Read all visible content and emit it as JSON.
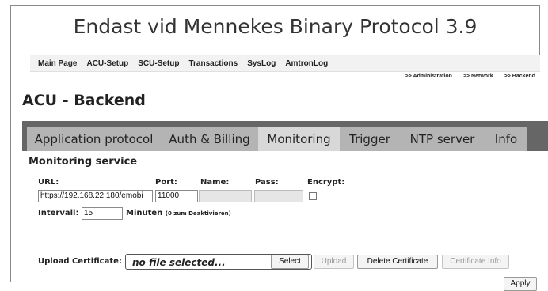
{
  "heading": "Endast vid Mennekes Binary Protocol 3.9",
  "topmenu": [
    "Main Page",
    "ACU-Setup",
    "SCU-Setup",
    "Transactions",
    "SysLog",
    "AmtronLog"
  ],
  "breadcrumbs": [
    ">> Administration",
    ">> Network",
    ">> Backend"
  ],
  "page_title": "ACU - Backend",
  "tabs": [
    "Application protocol",
    "Auth & Billing",
    "Monitoring",
    "Trigger",
    "NTP server",
    "Info"
  ],
  "active_tab": "Monitoring",
  "section_title": "Monitoring service",
  "form": {
    "url_label": "URL:",
    "url_value": "https://192.168.22.180/emobi",
    "port_label": "Port:",
    "port_value": "11000",
    "name_label": "Name:",
    "name_value": "",
    "pass_label": "Pass:",
    "pass_value": "",
    "encrypt_label": "Encrypt:",
    "encrypt_checked": false,
    "intervall_label": "Intervall:",
    "intervall_value": "15",
    "minuten_label": "Minuten",
    "minuten_hint": "(0 zum Deaktivieren)"
  },
  "upload": {
    "label": "Upload Certificate:",
    "file_text": "no file selected...",
    "select": "Select",
    "upload": "Upload",
    "delete": "Delete Certificate",
    "info": "Certificate Info"
  },
  "apply": "Apply"
}
